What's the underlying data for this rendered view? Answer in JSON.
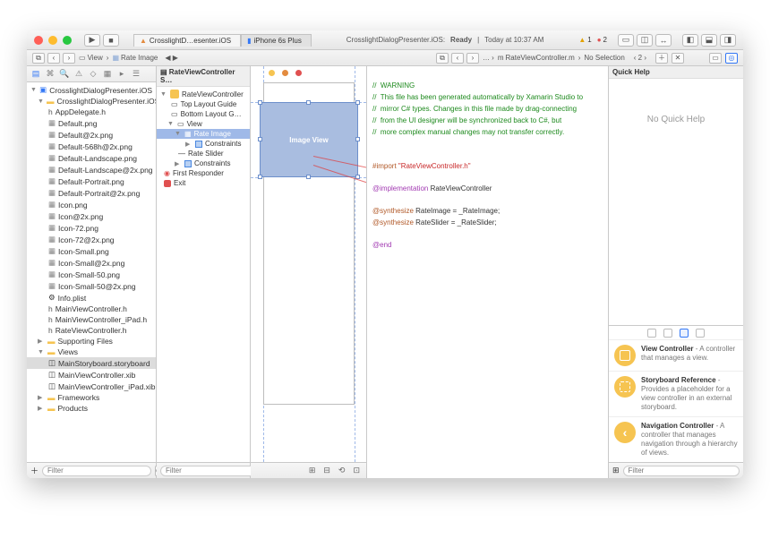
{
  "titlebar": {
    "tabs": [
      {
        "icon": "▲",
        "label": "CrosslightD…esenter.iOS"
      },
      {
        "icon": "📱",
        "label": "iPhone 6s Plus"
      }
    ],
    "status_left": "CrosslightDialogPresenter.iOS:",
    "status_state": "Ready",
    "status_sep": "|",
    "status_time": "Today at 10:37 AM",
    "warnings": "1",
    "errors": "2"
  },
  "pathbar_left": {
    "history": "‹ ›",
    "view_label": "View",
    "seg1": "Rate Image"
  },
  "pathbar_right": {
    "file": "RateViewController.m",
    "sel": "No Selection",
    "counter": "‹ 2 ›"
  },
  "navigator": {
    "root": "CrosslightDialogPresenter.iOS",
    "group1": "CrosslightDialogPresenter.iOS",
    "files": [
      "AppDelegate.h",
      "Default.png",
      "Default@2x.png",
      "Default-568h@2x.png",
      "Default-Landscape.png",
      "Default-Landscape@2x.png",
      "Default-Portrait.png",
      "Default-Portrait@2x.png",
      "Icon.png",
      "Icon@2x.png",
      "Icon-72.png",
      "Icon-72@2x.png",
      "Icon-Small.png",
      "Icon-Small@2x.png",
      "Icon-Small-50.png",
      "Icon-Small-50@2x.png",
      "Info.plist",
      "MainViewController.h",
      "MainViewController_iPad.h",
      "RateViewController.h"
    ],
    "supporting": "Supporting Files",
    "views": "Views",
    "view_items": [
      "MainStoryboard.storyboard",
      "MainViewController.xib",
      "MainViewController_iPad.xib"
    ],
    "frameworks": "Frameworks",
    "products": "Products",
    "filter_placeholder": "Filter"
  },
  "outline": {
    "header": "RateViewController S…",
    "scene": "RateViewController",
    "top_guide": "Top Layout Guide",
    "bottom_guide": "Bottom Layout G…",
    "view": "View",
    "rate_image": "Rate Image",
    "constraints1": "Constraints",
    "rate_slider": "Rate Slider",
    "constraints2": "Constraints",
    "first_responder": "First Responder",
    "exit": "Exit",
    "filter_placeholder": "Filter"
  },
  "canvas": {
    "imageview_label": "Image View"
  },
  "code": {
    "l1": "//  WARNING",
    "l2": "//  This file has been generated automatically by Xamarin Studio to",
    "l3": "//  mirror C# types. Changes in this file made by drag-connecting",
    "l4": "//  from the UI designer will be synchronized back to C#, but",
    "l5": "//  more complex manual changes may not transfer correctly.",
    "l6": "",
    "import_kw": "#import ",
    "import_val": "\"RateViewController.h\"",
    "impl_kw": "@implementation",
    "impl_val": " RateViewController",
    "syn1_kw": "@synthesize",
    "syn1_val": " RateImage = _RateImage;",
    "syn2_kw": "@synthesize",
    "syn2_val": " RateSlider = _RateSlider;",
    "end_kw": "@end"
  },
  "inspector": {
    "title": "Quick Help",
    "empty": "No Quick Help",
    "lib": [
      {
        "title": "View Controller",
        "desc": " - A controller that manages a view."
      },
      {
        "title": "Storyboard Reference",
        "desc": " - Provides a placeholder for a view controller in an external storyboard."
      },
      {
        "title": "Navigation Controller",
        "desc": " - A controller that manages navigation through a hierarchy of views."
      }
    ],
    "filter_placeholder": "Filter"
  }
}
